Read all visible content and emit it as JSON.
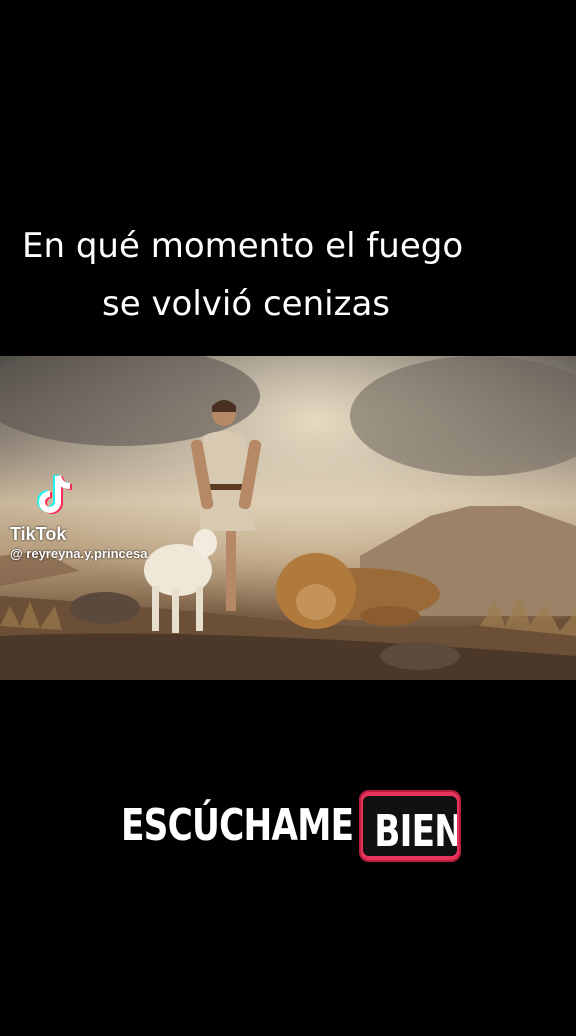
{
  "caption": {
    "line1": "En qué momento el fuego",
    "line2": "se volvió cenizas"
  },
  "watermark": {
    "brand": "TikTok",
    "handle": "@ reyreyna.y.princesa",
    "icon": "tiktok-logo-icon"
  },
  "cta": {
    "word1": "ESCÚCHAME",
    "word2": "BIEN",
    "highlight_color": "#e8345a"
  }
}
